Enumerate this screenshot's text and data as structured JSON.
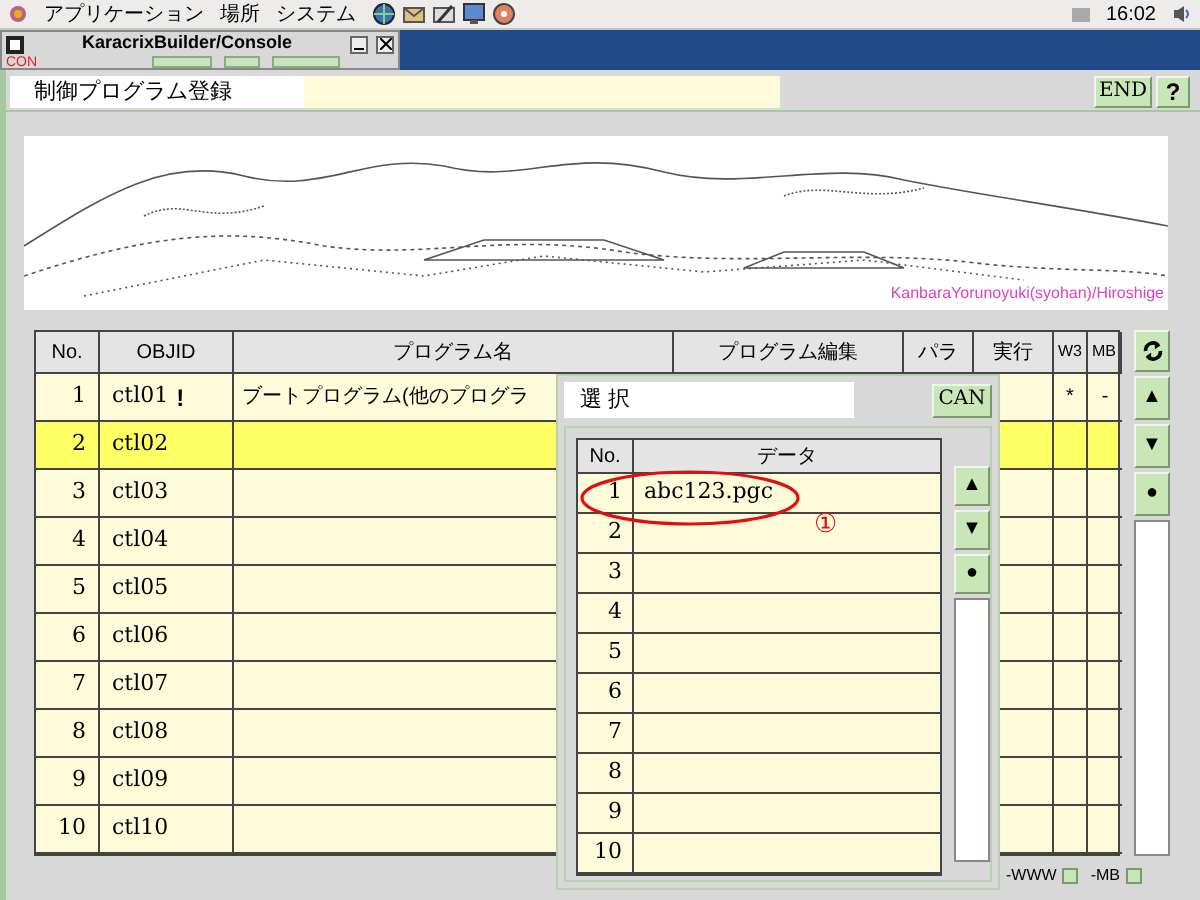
{
  "top_panel": {
    "menus": [
      "アプリケーション",
      "場所",
      "システム"
    ],
    "clock": "16:02"
  },
  "console_window": {
    "title": "KaracrixBuilder/Console",
    "toolbar_label": "CON"
  },
  "header": {
    "title": "制御プログラム登録",
    "end_button": "END",
    "help_button": "?"
  },
  "banner": {
    "caption": "KanbaraYorunoyuki(syohan)/Hiroshige"
  },
  "table": {
    "columns": [
      "No.",
      "OBJID",
      "プログラム名",
      "プログラム編集",
      "パラ",
      "実行",
      "W3",
      "MB"
    ],
    "rows": [
      {
        "no": "1",
        "objid": "ctl01",
        "flag": "!",
        "program_name": "ブートプログラム(他のプログラ",
        "w3": "*",
        "mb": "-",
        "selected": false
      },
      {
        "no": "2",
        "objid": "ctl02",
        "selected": true
      },
      {
        "no": "3",
        "objid": "ctl03",
        "selected": false
      },
      {
        "no": "4",
        "objid": "ctl04",
        "selected": false
      },
      {
        "no": "5",
        "objid": "ctl05",
        "selected": false
      },
      {
        "no": "6",
        "objid": "ctl06",
        "selected": false
      },
      {
        "no": "7",
        "objid": "ctl07",
        "selected": false
      },
      {
        "no": "8",
        "objid": "ctl08",
        "selected": false
      },
      {
        "no": "9",
        "objid": "ctl09",
        "selected": false
      },
      {
        "no": "10",
        "objid": "ctl10",
        "selected": false
      }
    ]
  },
  "side_buttons": [
    "▲",
    "▼",
    "●"
  ],
  "options": [
    {
      "label": "-WWW",
      "checked": false
    },
    {
      "label": "-MB",
      "checked": false
    }
  ],
  "dialog": {
    "title": "選 択",
    "cancel_button": "CAN",
    "columns": [
      "No.",
      "データ"
    ],
    "rows": [
      {
        "no": "1",
        "data": "abc123.pgc"
      },
      {
        "no": "2"
      },
      {
        "no": "3"
      },
      {
        "no": "4"
      },
      {
        "no": "5"
      },
      {
        "no": "6"
      },
      {
        "no": "7"
      },
      {
        "no": "8"
      },
      {
        "no": "9"
      },
      {
        "no": "10"
      }
    ],
    "annotation": "①",
    "scroll_buttons": [
      "▲",
      "▼",
      "●"
    ]
  }
}
